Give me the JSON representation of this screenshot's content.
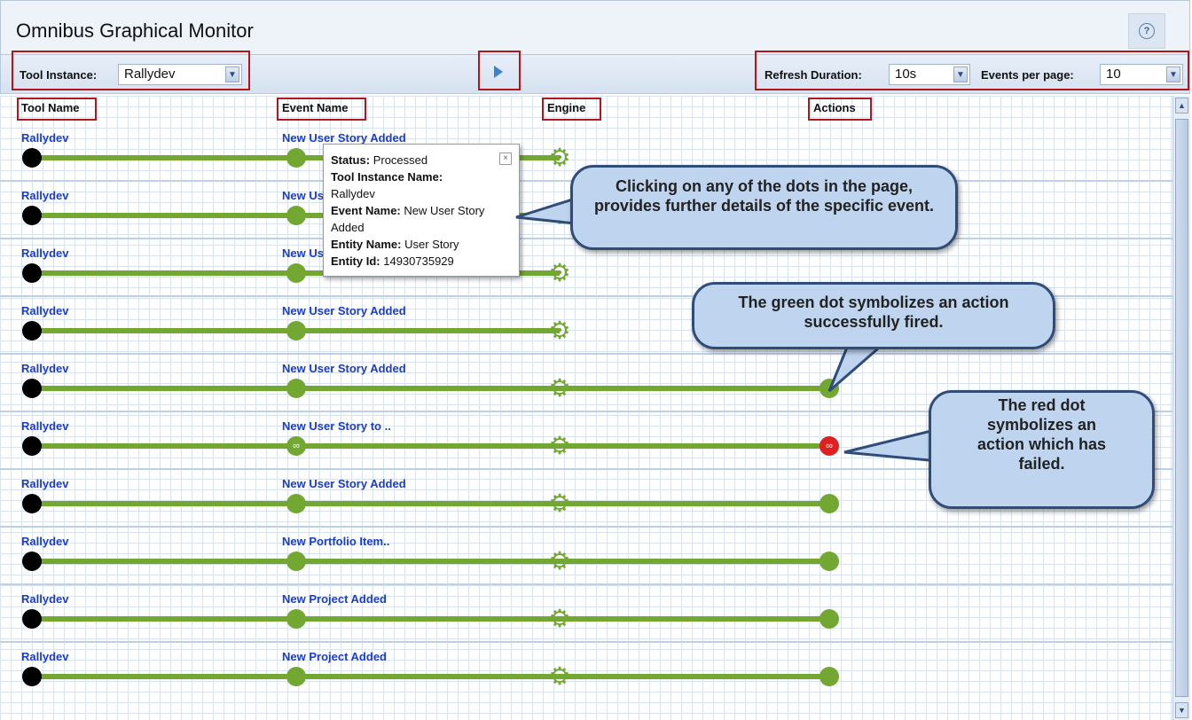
{
  "app": {
    "title": "Omnibus Graphical Monitor",
    "help_glyph": "?"
  },
  "toolbar": {
    "tool_instance_label": "Tool Instance:",
    "tool_instance_value": "Rallydev",
    "refresh_label": "Refresh Duration:",
    "refresh_value": "10s",
    "events_label": "Events per page:",
    "events_value": "10"
  },
  "columns": {
    "tool": "Tool Name",
    "event": "Event Name",
    "engine": "Engine",
    "actions": "Actions"
  },
  "rows": [
    {
      "tool": "Rallydev",
      "event": "New User Story Added",
      "event_dot": "green",
      "action": "none"
    },
    {
      "tool": "Rallydev",
      "event": "New User Story Added",
      "event_dot": "green",
      "action": "none"
    },
    {
      "tool": "Rallydev",
      "event": "New User Story Added",
      "event_dot": "green",
      "action": "none"
    },
    {
      "tool": "Rallydev",
      "event": "New User Story Added",
      "event_dot": "green",
      "action": "none"
    },
    {
      "tool": "Rallydev",
      "event": "New User Story Added",
      "event_dot": "green",
      "action": "green"
    },
    {
      "tool": "Rallydev",
      "event": "New User Story to ..",
      "event_dot": "linked",
      "action": "red"
    },
    {
      "tool": "Rallydev",
      "event": "New User Story Added",
      "event_dot": "green",
      "action": "green"
    },
    {
      "tool": "Rallydev",
      "event": "New Portfolio Item..",
      "event_dot": "green",
      "action": "green"
    },
    {
      "tool": "Rallydev",
      "event": "New Project Added",
      "event_dot": "green",
      "action": "green"
    },
    {
      "tool": "Rallydev",
      "event": "New Project Added",
      "event_dot": "green",
      "action": "green"
    }
  ],
  "popup": {
    "status_label": "Status:",
    "status_value": "Processed",
    "tool_instance_label": "Tool Instance Name:",
    "tool_instance_value": "Rallydev",
    "event_name_label": "Event Name:",
    "event_name_value": "New User Story Added",
    "entity_name_label": "Entity Name:",
    "entity_name_value": "User Story",
    "entity_id_label": "Entity Id:",
    "entity_id_value": "14930735929",
    "close_glyph": "×"
  },
  "callouts": {
    "dots": "Clicking on any of the dots in the page, provides further details of the specific event.",
    "green": "The green dot symbolizes an action successfully fired.",
    "red": "The red dot symbolizes an action which has failed."
  },
  "colors": {
    "accent_green": "#72a832",
    "failure_red": "#e0201e",
    "link_blue": "#1a3cc7",
    "annotation_red": "#b3151c"
  },
  "icons": {
    "engine": "gear-icon",
    "play": "play-icon",
    "help": "help-icon",
    "dropdown": "chevron-down-icon"
  }
}
